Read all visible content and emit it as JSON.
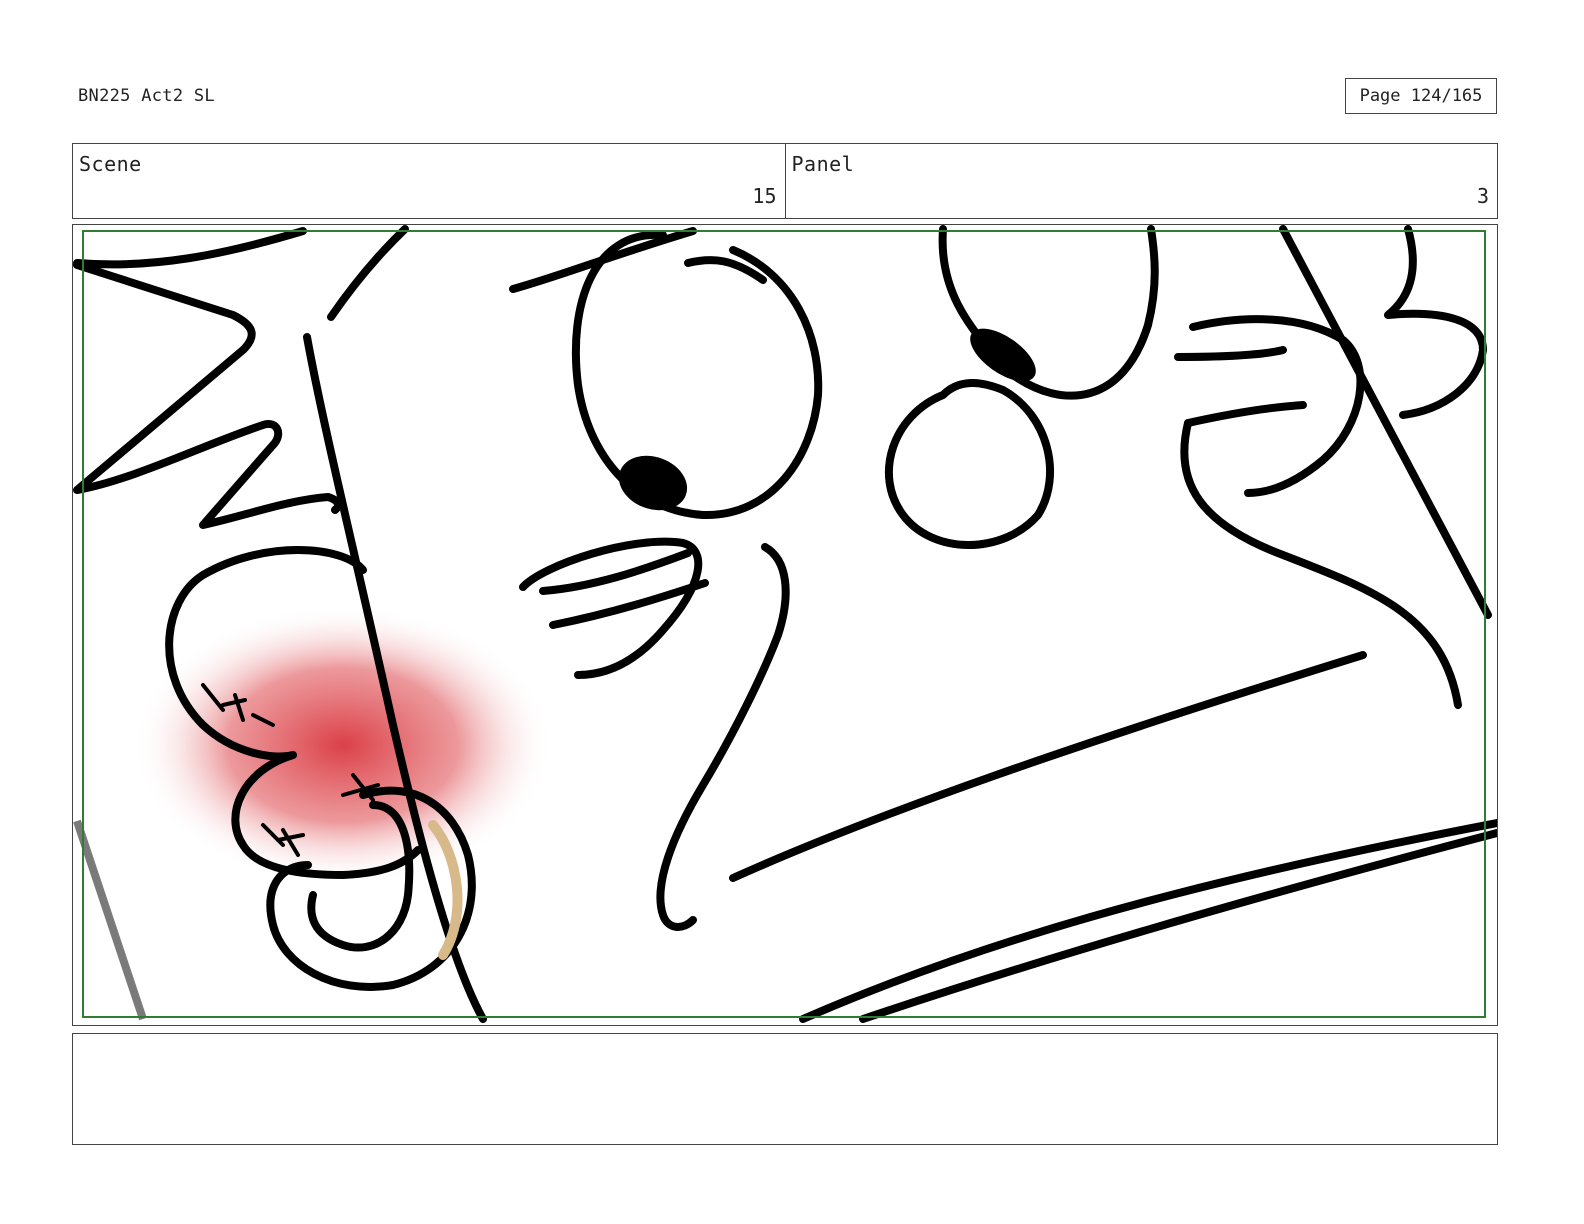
{
  "document": {
    "title": "BN225 Act2 SL",
    "page_label": "Page 124/165"
  },
  "header": {
    "scene_label": "Scene",
    "scene_number": "15",
    "panel_label": "Panel",
    "panel_number": "3"
  },
  "notes": {
    "text": ""
  },
  "colors": {
    "safe_area_border": "#2e7d32",
    "ink": "#000000",
    "blush_red": "#d9363e",
    "ring_tan": "#d8b98a",
    "frame_border": "#444444"
  }
}
